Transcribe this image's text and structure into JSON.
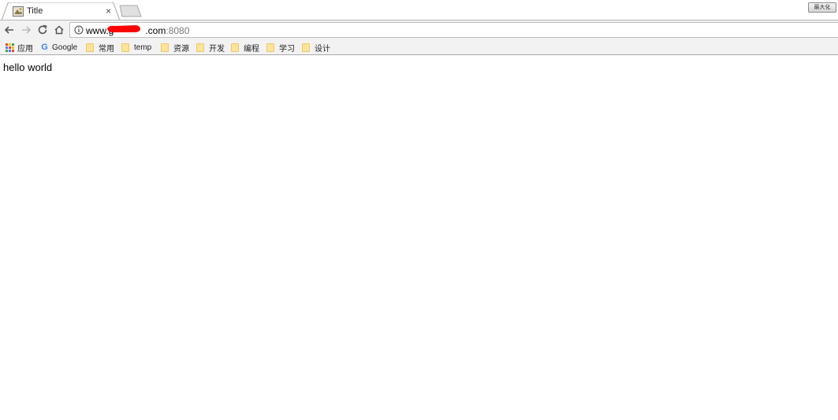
{
  "tab": {
    "title": "Title",
    "close": "×"
  },
  "window_badge": "最大化",
  "toolbar": {
    "url_prefix": "www.g",
    "url_suffix": ".com",
    "url_port": ":8080",
    "redaction_color": "#ff0000"
  },
  "bookmarks": {
    "apps_label": "应用",
    "google_label": "Google",
    "folders": [
      "常用",
      "temp",
      "资源",
      "开发",
      "编程",
      "学习",
      "设计"
    ]
  },
  "content": {
    "text": "hello world"
  }
}
